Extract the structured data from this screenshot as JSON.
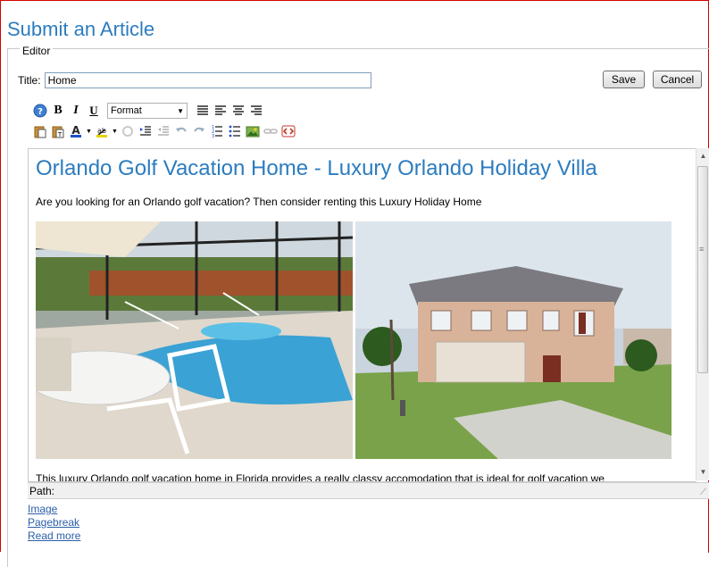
{
  "page": {
    "title": "Submit an Article"
  },
  "editor": {
    "legend": "Editor",
    "title_label": "Title:",
    "title_value": "Home",
    "save_label": "Save",
    "cancel_label": "Cancel",
    "toolbar": {
      "row1": [
        "help-icon",
        "bold-icon",
        "italic-icon",
        "underline-icon",
        "format-select",
        "align-left-icon",
        "align-center-icon",
        "align-right-icon",
        "align-justify-icon"
      ],
      "format_value": "Format",
      "row2": [
        "paste-icon",
        "paste-text-icon",
        "text-color-icon",
        "highlight-color-icon",
        "unlink-icon",
        "indent-icon",
        "outdent-icon",
        "undo-icon",
        "redo-icon",
        "numbered-list-icon",
        "bullet-list-icon",
        "image-icon",
        "link-icon",
        "html-source-icon"
      ],
      "row1_glyphs": {
        "bold": "B",
        "italic": "I",
        "underline": "U"
      }
    },
    "content": {
      "heading": "Orlando Golf Vacation Home - Luxury Orlando Holiday Villa",
      "intro": "Are you looking for an Orlando golf vacation? Then consider renting this Luxury Holiday Home",
      "cut_line": "This luxury Orlando golf vacation home in Florida provides a really classy accomodation that is ideal for golf vacation we"
    },
    "path_label": "Path:"
  },
  "links": {
    "image": "Image",
    "pagebreak": "Pagebreak",
    "readmore": "Read more"
  },
  "colors": {
    "accent": "#2c7cbf",
    "frame": "#d40000",
    "link": "#2c5ea8"
  }
}
